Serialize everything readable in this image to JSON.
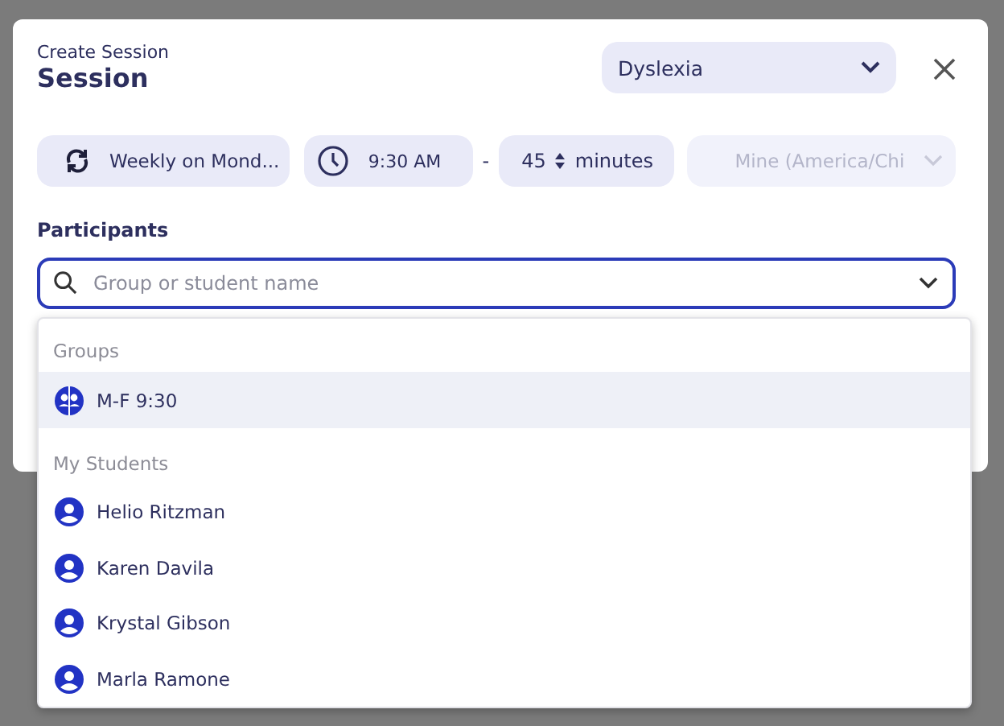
{
  "dialog": {
    "subtitle": "Create Session",
    "title": "Session",
    "program_select": {
      "value": "Dyslexia"
    }
  },
  "schedule": {
    "recurrence": "Weekly on Mond...",
    "start_time": "9:30 AM",
    "separator": "-",
    "duration": "45",
    "duration_unit": "minutes",
    "timezone": {
      "value": "Mine (America/Chi",
      "disabled": true
    }
  },
  "participants": {
    "label": "Participants",
    "search": {
      "placeholder": "Group or student name"
    },
    "sections": [
      {
        "heading": "Groups",
        "items": [
          {
            "kind": "group",
            "name": "M-F 9:30",
            "selected": true
          }
        ]
      },
      {
        "heading": "My Students",
        "items": [
          {
            "kind": "student",
            "name": "Helio Ritzman",
            "selected": false
          },
          {
            "kind": "student",
            "name": "Karen Davila",
            "selected": false
          },
          {
            "kind": "student",
            "name": "Krystal Gibson",
            "selected": false
          },
          {
            "kind": "student",
            "name": "Marla Ramone",
            "selected": false
          }
        ]
      }
    ]
  }
}
